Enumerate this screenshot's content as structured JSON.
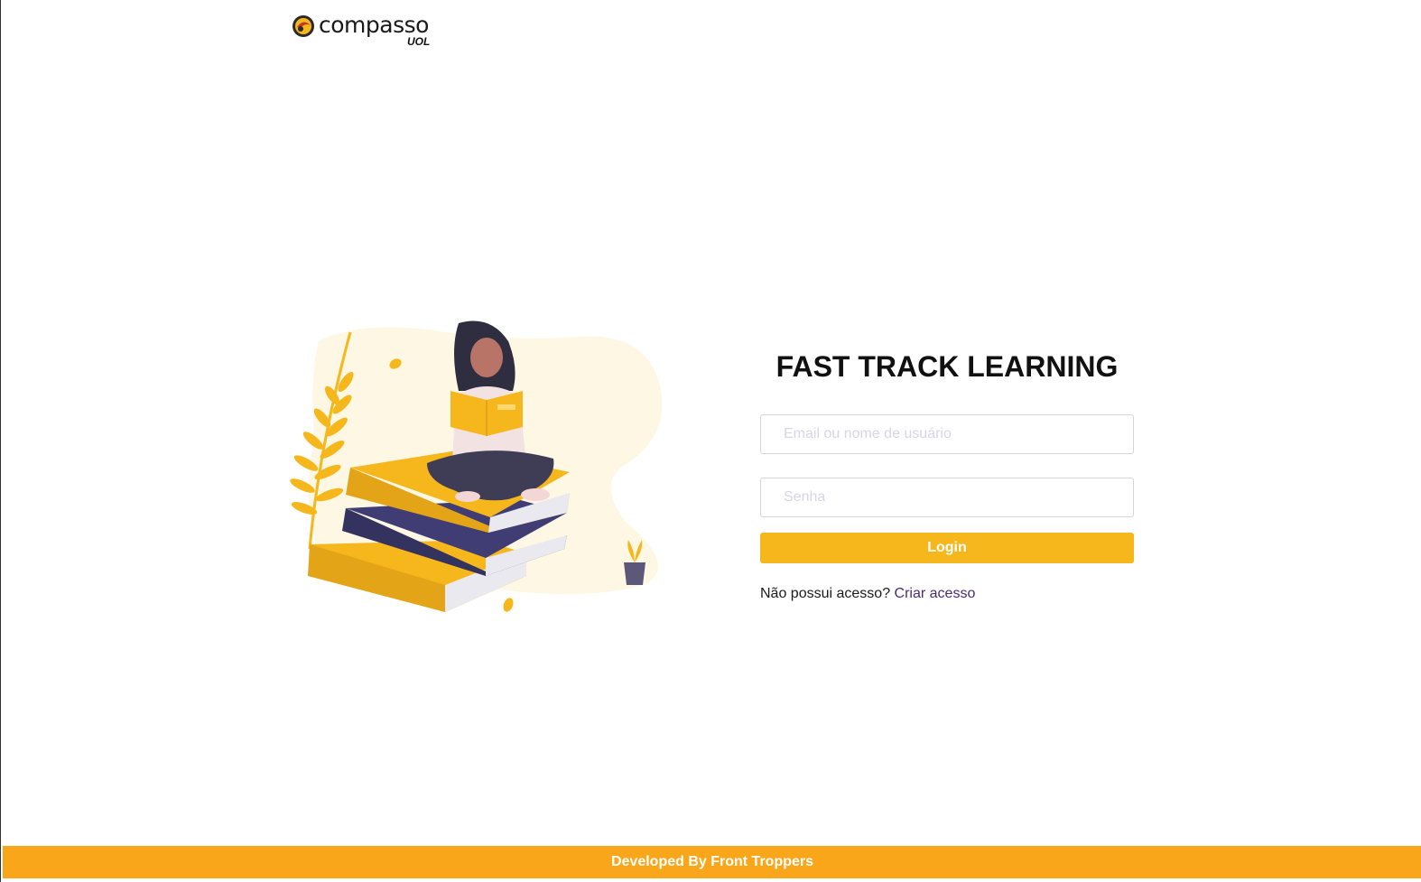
{
  "brand": {
    "name": "compasso",
    "sub": "UOL",
    "colors": {
      "accent": "#f6b71c",
      "footer": "#faa61a",
      "link": "#4b2a7a"
    }
  },
  "illustration": {
    "icon": "woman-reading-on-books-illustration"
  },
  "login": {
    "title": "FAST TRACK LEARNING",
    "email_placeholder": "Email ou nome de usuário",
    "password_placeholder": "Senha",
    "button_label": "Login",
    "signup_prompt": "Não possui acesso?",
    "signup_link": "Criar acesso"
  },
  "footer": {
    "text": "Developed By Front Troppers"
  }
}
